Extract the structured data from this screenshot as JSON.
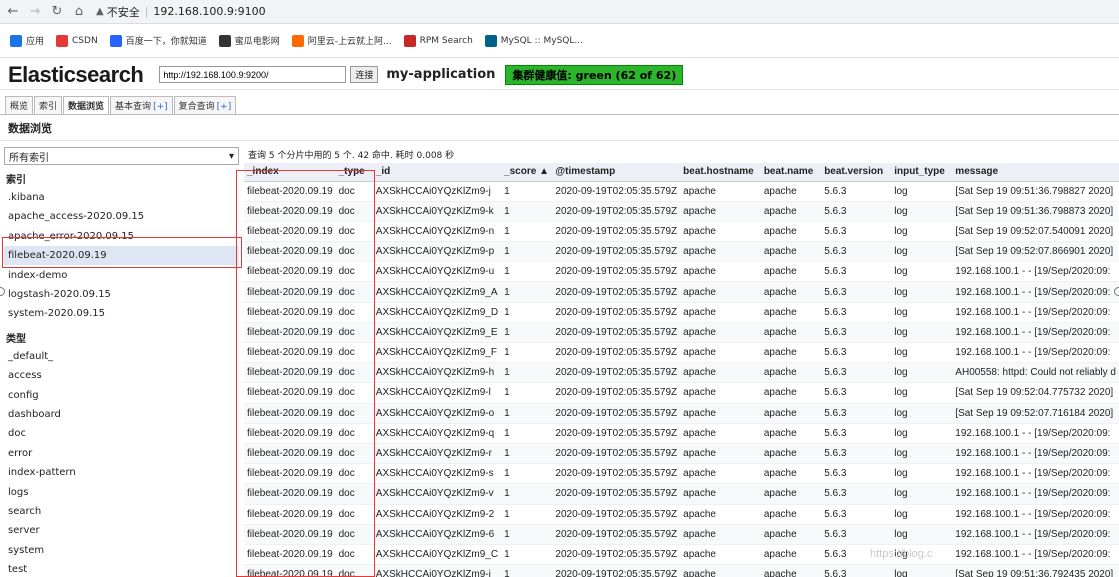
{
  "browser": {
    "insecure_label": "不安全",
    "url": "192.168.100.9:9100"
  },
  "bookmarks": [
    {
      "label": "应用",
      "icon": "apps-icon",
      "color": "#1a73e8"
    },
    {
      "label": "CSDN",
      "icon": "csdn-icon",
      "color": "#e53935"
    },
    {
      "label": "百度一下，你就知道",
      "icon": "baidu-icon",
      "color": "#2962ff"
    },
    {
      "label": "蜜瓜电影网",
      "icon": "film-icon",
      "color": "#333333"
    },
    {
      "label": "阿里云-上云就上阿...",
      "icon": "aliyun-icon",
      "color": "#ff6a00"
    },
    {
      "label": "RPM Search",
      "icon": "rpm-icon",
      "color": "#c62828"
    },
    {
      "label": "MySQL :: MySQL...",
      "icon": "mysql-icon",
      "color": "#00618a"
    }
  ],
  "header": {
    "logo": "Elasticsearch",
    "url_value": "http://192.168.100.9:9200/",
    "connect_label": "连接",
    "cluster_name": "my-application",
    "health_label": "集群健康值: green (62 of 62)",
    "health_color": "#2cb52c"
  },
  "tabs": [
    {
      "label": "概览",
      "plus": ""
    },
    {
      "label": "索引",
      "plus": ""
    },
    {
      "label": "数据浏览",
      "plus": ""
    },
    {
      "label": "基本查询",
      "plus": "[+]"
    },
    {
      "label": "复合查询",
      "plus": "[+]"
    }
  ],
  "page_title": "数据浏览",
  "sidebar": {
    "select_value": "所有索引",
    "index_heading": "索引",
    "indices": [
      ".kibana",
      "apache_access-2020.09.15",
      "apache_error-2020.09.15",
      "filebeat-2020.09.19",
      "index-demo",
      "logstash-2020.09.15",
      "system-2020.09.15"
    ],
    "selected_index": "filebeat-2020.09.19",
    "type_heading": "类型",
    "types": [
      "_default_",
      "access",
      "config",
      "dashboard",
      "doc",
      "error",
      "index-pattern",
      "logs",
      "search",
      "server",
      "system",
      "test"
    ]
  },
  "results": {
    "query_info": "查询 5 个分片中用的 5 个. 42 命中. 耗时 0.008 秒",
    "columns": [
      "_index",
      "_type",
      "_id",
      "_score ▲",
      "@timestamp",
      "beat.hostname",
      "beat.name",
      "beat.version",
      "input_type",
      "message"
    ],
    "rows": [
      [
        "filebeat-2020.09.19",
        "doc",
        "AXSkHCCAi0YQzKlZm9-j",
        "1",
        "2020-09-19T02:05:35.579Z",
        "apache",
        "apache",
        "5.6.3",
        "log",
        "[Sat Sep 19 09:51:36.798827 2020]"
      ],
      [
        "filebeat-2020.09.19",
        "doc",
        "AXSkHCCAi0YQzKlZm9-k",
        "1",
        "2020-09-19T02:05:35.579Z",
        "apache",
        "apache",
        "5.6.3",
        "log",
        "[Sat Sep 19 09:51:36.798873 2020]"
      ],
      [
        "filebeat-2020.09.19",
        "doc",
        "AXSkHCCAi0YQzKlZm9-n",
        "1",
        "2020-09-19T02:05:35.579Z",
        "apache",
        "apache",
        "5.6.3",
        "log",
        "[Sat Sep 19 09:52:07.540091 2020]"
      ],
      [
        "filebeat-2020.09.19",
        "doc",
        "AXSkHCCAi0YQzKlZm9-p",
        "1",
        "2020-09-19T02:05:35.579Z",
        "apache",
        "apache",
        "5.6.3",
        "log",
        "[Sat Sep 19 09:52:07.866901 2020]"
      ],
      [
        "filebeat-2020.09.19",
        "doc",
        "AXSkHCCAi0YQzKlZm9-u",
        "1",
        "2020-09-19T02:05:35.579Z",
        "apache",
        "apache",
        "5.6.3",
        "log",
        "192.168.100.1 - - [19/Sep/2020:09:"
      ],
      [
        "filebeat-2020.09.19",
        "doc",
        "AXSkHCCAi0YQzKlZm9_A",
        "1",
        "2020-09-19T02:05:35.579Z",
        "apache",
        "apache",
        "5.6.3",
        "log",
        "192.168.100.1 - - [19/Sep/2020:09:"
      ],
      [
        "filebeat-2020.09.19",
        "doc",
        "AXSkHCCAi0YQzKlZm9_D",
        "1",
        "2020-09-19T02:05:35.579Z",
        "apache",
        "apache",
        "5.6.3",
        "log",
        "192.168.100.1 - - [19/Sep/2020:09:"
      ],
      [
        "filebeat-2020.09.19",
        "doc",
        "AXSkHCCAi0YQzKlZm9_E",
        "1",
        "2020-09-19T02:05:35.579Z",
        "apache",
        "apache",
        "5.6.3",
        "log",
        "192.168.100.1 - - [19/Sep/2020:09:"
      ],
      [
        "filebeat-2020.09.19",
        "doc",
        "AXSkHCCAi0YQzKlZm9_F",
        "1",
        "2020-09-19T02:05:35.579Z",
        "apache",
        "apache",
        "5.6.3",
        "log",
        "192.168.100.1 - - [19/Sep/2020:09:"
      ],
      [
        "filebeat-2020.09.19",
        "doc",
        "AXSkHCCAi0YQzKlZm9-h",
        "1",
        "2020-09-19T02:05:35.579Z",
        "apache",
        "apache",
        "5.6.3",
        "log",
        "AH00558: httpd: Could not reliably d"
      ],
      [
        "filebeat-2020.09.19",
        "doc",
        "AXSkHCCAi0YQzKlZm9-l",
        "1",
        "2020-09-19T02:05:35.579Z",
        "apache",
        "apache",
        "5.6.3",
        "log",
        "[Sat Sep 19 09:52:04.775732 2020]"
      ],
      [
        "filebeat-2020.09.19",
        "doc",
        "AXSkHCCAi0YQzKlZm9-o",
        "1",
        "2020-09-19T02:05:35.579Z",
        "apache",
        "apache",
        "5.6.3",
        "log",
        "[Sat Sep 19 09:52:07.716184 2020]"
      ],
      [
        "filebeat-2020.09.19",
        "doc",
        "AXSkHCCAi0YQzKlZm9-q",
        "1",
        "2020-09-19T02:05:35.579Z",
        "apache",
        "apache",
        "5.6.3",
        "log",
        "192.168.100.1 - - [19/Sep/2020:09:"
      ],
      [
        "filebeat-2020.09.19",
        "doc",
        "AXSkHCCAi0YQzKlZm9-r",
        "1",
        "2020-09-19T02:05:35.579Z",
        "apache",
        "apache",
        "5.6.3",
        "log",
        "192.168.100.1 - - [19/Sep/2020:09:"
      ],
      [
        "filebeat-2020.09.19",
        "doc",
        "AXSkHCCAi0YQzKlZm9-s",
        "1",
        "2020-09-19T02:05:35.579Z",
        "apache",
        "apache",
        "5.6.3",
        "log",
        "192.168.100.1 - - [19/Sep/2020:09:"
      ],
      [
        "filebeat-2020.09.19",
        "doc",
        "AXSkHCCAi0YQzKlZm9-v",
        "1",
        "2020-09-19T02:05:35.579Z",
        "apache",
        "apache",
        "5.6.3",
        "log",
        "192.168.100.1 - - [19/Sep/2020:09:"
      ],
      [
        "filebeat-2020.09.19",
        "doc",
        "AXSkHCCAi0YQzKlZm9-2",
        "1",
        "2020-09-19T02:05:35.579Z",
        "apache",
        "apache",
        "5.6.3",
        "log",
        "192.168.100.1 - - [19/Sep/2020:09:"
      ],
      [
        "filebeat-2020.09.19",
        "doc",
        "AXSkHCCAi0YQzKlZm9-6",
        "1",
        "2020-09-19T02:05:35.579Z",
        "apache",
        "apache",
        "5.6.3",
        "log",
        "192.168.100.1 - - [19/Sep/2020:09:"
      ],
      [
        "filebeat-2020.09.19",
        "doc",
        "AXSkHCCAi0YQzKlZm9_C",
        "1",
        "2020-09-19T02:05:35.579Z",
        "apache",
        "apache",
        "5.6.3",
        "log",
        "192.168.100.1 - - [19/Sep/2020:09:"
      ],
      [
        "filebeat-2020.09.19",
        "doc",
        "AXSkHCCAi0YQzKlZm9-i",
        "1",
        "2020-09-19T02:05:35.579Z",
        "apache",
        "apache",
        "5.6.3",
        "log",
        "[Sat Sep 19 09:51:36.792435 2020]"
      ]
    ]
  },
  "watermark": "https://blog.c",
  "highlight_color": "#e53935"
}
